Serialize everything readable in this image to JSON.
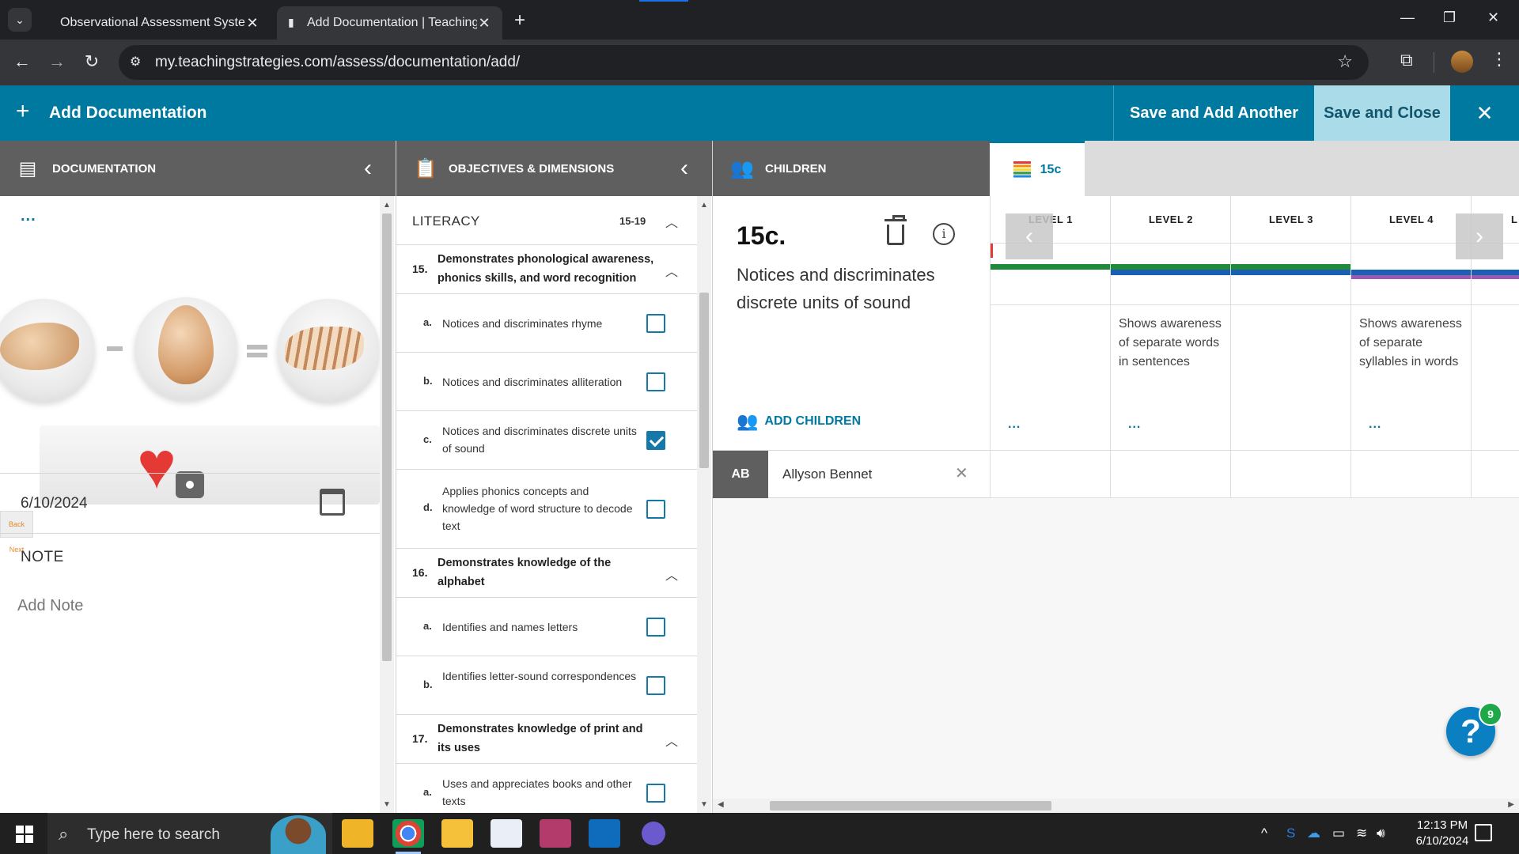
{
  "browser": {
    "tabs": [
      {
        "title": "Observational Assessment Syste",
        "close": "✕"
      },
      {
        "title": "Add Documentation | Teaching",
        "close": "✕"
      }
    ],
    "new_tab": "+",
    "url": "my.teachingstrategies.com/assess/documentation/add/"
  },
  "header": {
    "title": "Add Documentation",
    "save_add_another": "Save and Add Another",
    "save_close": "Save and Close"
  },
  "panels": {
    "documentation": "DOCUMENTATION",
    "objectives": "OBJECTIVES & DIMENSIONS",
    "children": "CHILDREN",
    "active_tab": "15c"
  },
  "documentation": {
    "menu": "...",
    "date": "6/10/2024",
    "note_label": "NOTE",
    "note_placeholder": "Add Note",
    "media_nav": "Back Next"
  },
  "objectives": {
    "section": "LITERACY",
    "range": "15-19",
    "groups": [
      {
        "num": "15.",
        "title": "Demonstrates phonological awareness, phonics skills, and word recognition",
        "items": [
          {
            "letter": "a.",
            "text": "Notices and discriminates rhyme",
            "checked": false
          },
          {
            "letter": "b.",
            "text": "Notices and discriminates alliteration",
            "checked": false
          },
          {
            "letter": "c.",
            "text": "Notices and discriminates discrete units of sound",
            "checked": true
          },
          {
            "letter": "d.",
            "text": "Applies phonics concepts and knowledge of word structure to decode text",
            "checked": false
          }
        ]
      },
      {
        "num": "16.",
        "title": "Demonstrates knowledge of the alphabet",
        "items": [
          {
            "letter": "a.",
            "text": "Identifies and names letters",
            "checked": false
          },
          {
            "letter": "b.",
            "text": "Identifies letter-sound correspondences",
            "checked": false
          }
        ]
      },
      {
        "num": "17.",
        "title": "Demonstrates knowledge of print and its uses",
        "items": [
          {
            "letter": "a.",
            "text": "Uses and appreciates books and other texts",
            "checked": false
          }
        ]
      }
    ]
  },
  "detail": {
    "code": "15c.",
    "description": "Notices and discriminates discrete units of sound",
    "add_children": "ADD CHILDREN"
  },
  "child": {
    "initials": "AB",
    "name": "Allyson Bennet"
  },
  "levels": {
    "headers": [
      "LEVEL 1",
      "LEVEL 2",
      "LEVEL 3",
      "LEVEL 4",
      "L"
    ],
    "descriptions": [
      "",
      "Shows awareness of separate words in sentences",
      "",
      "Shows awareness of separate syllables in words",
      ""
    ],
    "dots": [
      "...",
      "...",
      "",
      "...",
      ""
    ],
    "colors": {
      "green": "#1e8a3a",
      "blue": "#1b5fb3",
      "purple": "#9b59b6",
      "red": "#e53935"
    }
  },
  "help": {
    "label": "?",
    "badge": "9"
  },
  "taskbar": {
    "search_placeholder": "Type here to search",
    "time": "12:13 PM",
    "date": "6/10/2024"
  }
}
